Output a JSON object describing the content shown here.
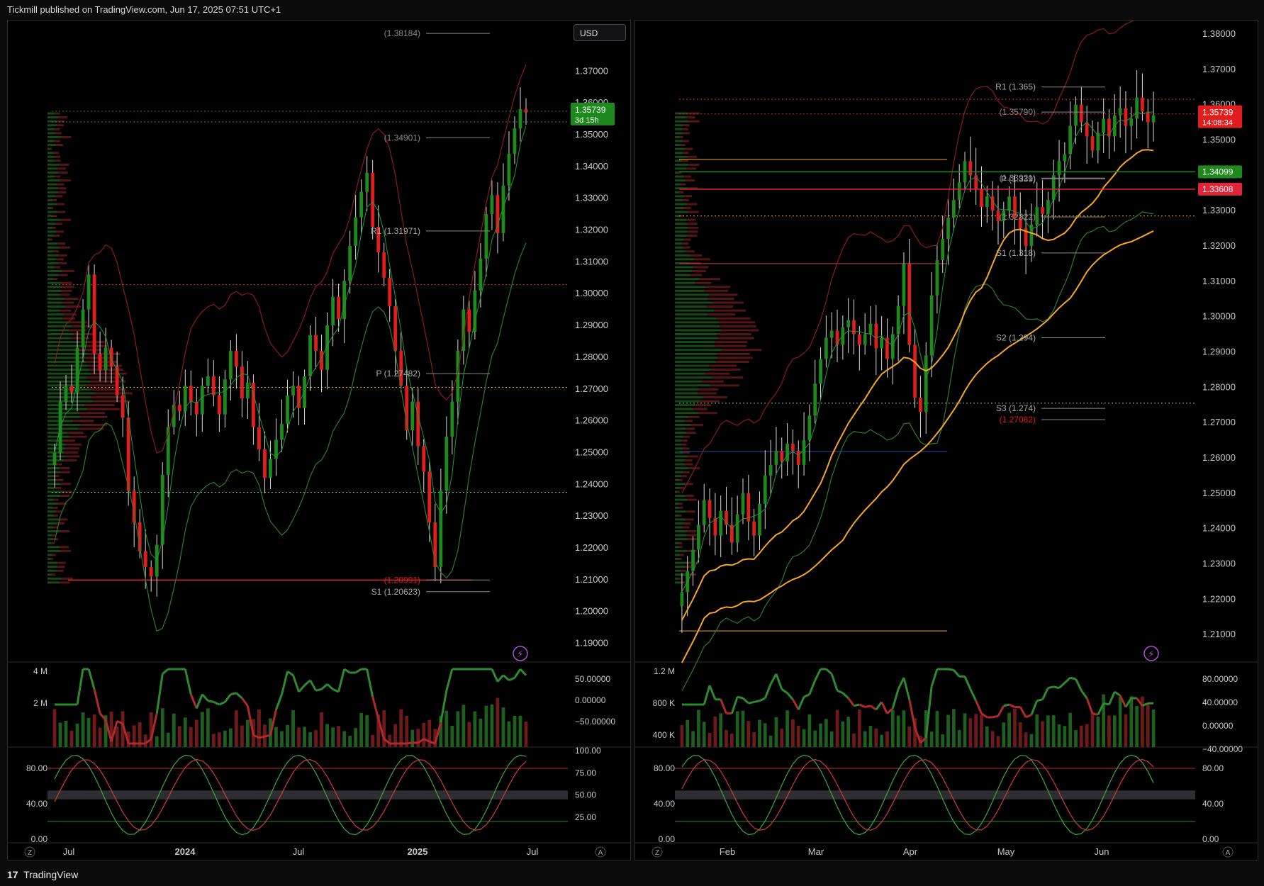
{
  "header": {
    "published": "Tickmill published on TradingView.com, Jun 17, 2025 07:51 UTC+1"
  },
  "footer": {
    "brand_logo": "17",
    "brand": "TradingView"
  },
  "colors": {
    "bull": "#1e8a1e",
    "bear": "#e01e1e",
    "ema": "#f5a623",
    "bg": "#000000"
  },
  "icons": {
    "lightning": "lightning-icon",
    "axis_z": "Z",
    "axis_a": "A"
  },
  "chart_data": [
    {
      "id": "left",
      "type": "candlestick",
      "currency": "USD",
      "ylim": [
        1.185,
        1.385
      ],
      "y_ticks": [
        "1.37000",
        "1.36000",
        "1.35000",
        "1.34000",
        "1.33000",
        "1.32000",
        "1.31000",
        "1.30000",
        "1.29000",
        "1.28000",
        "1.27000",
        "1.26000",
        "1.25000",
        "1.24000",
        "1.23000",
        "1.22000",
        "1.21000",
        "1.20000",
        "1.19000"
      ],
      "x_ticks": [
        "Jul",
        "2024",
        "Jul",
        "2025",
        "Jul"
      ],
      "price_label": {
        "value": 1.35739,
        "text": "1.35739",
        "countdown": "3d 15h",
        "color": "#1e8a1e"
      },
      "pivot_labels": [
        {
          "text": "(1.38184)",
          "value": 1.38184,
          "color": "#888888"
        },
        {
          "text": "(1.34901)",
          "value": 1.34901,
          "color": "#888888"
        },
        {
          "text": "R1 (1.31971)",
          "value": 1.31971,
          "color": "#aaaaaa"
        },
        {
          "text": "P (1.27482)",
          "value": 1.27482,
          "color": "#aaaaaa"
        },
        {
          "text": "S1 (1.20623)",
          "value": 1.20623,
          "color": "#aaaaaa"
        },
        {
          "text": "(1.20991)",
          "value": 1.20991,
          "color": "#e01e1e"
        }
      ],
      "closes": [
        1.25,
        1.266,
        1.271,
        1.269,
        1.283,
        1.295,
        1.306,
        1.281,
        1.276,
        1.283,
        1.277,
        1.268,
        1.261,
        1.238,
        1.228,
        1.219,
        1.214,
        1.211,
        1.221,
        1.243,
        1.258,
        1.265,
        1.263,
        1.271,
        1.266,
        1.262,
        1.271,
        1.274,
        1.268,
        1.262,
        1.273,
        1.282,
        1.277,
        1.267,
        1.272,
        1.258,
        1.251,
        1.242,
        1.248,
        1.254,
        1.259,
        1.268,
        1.271,
        1.264,
        1.274,
        1.287,
        1.282,
        1.276,
        1.29,
        1.299,
        1.292,
        1.304,
        1.315,
        1.324,
        1.332,
        1.338,
        1.321,
        1.313,
        1.305,
        1.296,
        1.282,
        1.271,
        1.257,
        1.266,
        1.252,
        1.244,
        1.228,
        1.214,
        1.238,
        1.255,
        1.266,
        1.282,
        1.295,
        1.288,
        1.301,
        1.311,
        1.325,
        1.331,
        1.319,
        1.334,
        1.344,
        1.352,
        1.358,
        1.357
      ],
      "volume_axis": [
        "4 M",
        "2 M"
      ],
      "momentum_axis": [
        "50.00000",
        "0.00000",
        "−50.00000"
      ],
      "stoch_axis_left": [
        "80.00",
        "40.00",
        "0.00"
      ],
      "stoch_axis_right": [
        "100.00",
        "75.00",
        "50.00",
        "25.00"
      ]
    },
    {
      "id": "right",
      "type": "candlestick",
      "ylim": [
        1.203,
        1.383
      ],
      "y_ticks": [
        "1.38000",
        "1.37000",
        "1.36000",
        "1.35000",
        "1.34000",
        "1.33000",
        "1.32000",
        "1.31000",
        "1.30000",
        "1.29000",
        "1.28000",
        "1.27000",
        "1.26000",
        "1.25000",
        "1.24000",
        "1.23000",
        "1.22000",
        "1.21000"
      ],
      "x_ticks": [
        "Feb",
        "Mar",
        "Apr",
        "May",
        "Jun"
      ],
      "price_label": {
        "value": 1.35739,
        "text": "1.35739",
        "countdown": "14:08:34",
        "color": "#e01e1e"
      },
      "level_labels": [
        {
          "text": "1.34099",
          "value": 1.34099,
          "color": "#1e8a1e"
        },
        {
          "text": "1.33608",
          "value": 1.33608,
          "color": "#e0253a"
        }
      ],
      "pivot_labels": [
        {
          "text": "R1 (1.365)",
          "value": 1.365,
          "color": "#aaaaaa"
        },
        {
          "text": "(1.35790)",
          "value": 1.3579,
          "color": "#888888"
        },
        {
          "text": "(1.33921)",
          "value": 1.33921,
          "color": "#888888"
        },
        {
          "text": "P (1.339)",
          "value": 1.339,
          "color": "#aaaaaa"
        },
        {
          "text": "(1.32822)",
          "value": 1.32822,
          "color": "#888888"
        },
        {
          "text": "S1 (1.318)",
          "value": 1.318,
          "color": "#aaaaaa"
        },
        {
          "text": "S2 (1.294)",
          "value": 1.294,
          "color": "#aaaaaa"
        },
        {
          "text": "S3 (1.274)",
          "value": 1.274,
          "color": "#aaaaaa"
        },
        {
          "text": "(1.27082)",
          "value": 1.27082,
          "color": "#e01e1e"
        }
      ],
      "closes": [
        1.222,
        1.228,
        1.234,
        1.241,
        1.248,
        1.243,
        1.238,
        1.245,
        1.241,
        1.236,
        1.244,
        1.25,
        1.242,
        1.238,
        1.247,
        1.255,
        1.258,
        1.262,
        1.259,
        1.264,
        1.262,
        1.258,
        1.265,
        1.272,
        1.281,
        1.288,
        1.294,
        1.296,
        1.292,
        1.297,
        1.299,
        1.295,
        1.292,
        1.295,
        1.298,
        1.291,
        1.294,
        1.288,
        1.295,
        1.303,
        1.315,
        1.292,
        1.277,
        1.273,
        1.289,
        1.306,
        1.316,
        1.322,
        1.328,
        1.333,
        1.338,
        1.344,
        1.34,
        1.336,
        1.331,
        1.334,
        1.33,
        1.327,
        1.33,
        1.334,
        1.328,
        1.325,
        1.32,
        1.326,
        1.331,
        1.329,
        1.333,
        1.34,
        1.344,
        1.346,
        1.354,
        1.36,
        1.355,
        1.351,
        1.347,
        1.352,
        1.356,
        1.351,
        1.357,
        1.359,
        1.354,
        1.356,
        1.362,
        1.358,
        1.355,
        1.357
      ],
      "volume_axis": [
        "1.2 M",
        "800 K",
        "400 K"
      ],
      "momentum_axis": [
        "80.00000",
        "40.00000",
        "0.00000",
        "−40.00000"
      ],
      "stoch_axis": [
        "80.00",
        "40.00",
        "0.00"
      ]
    }
  ]
}
